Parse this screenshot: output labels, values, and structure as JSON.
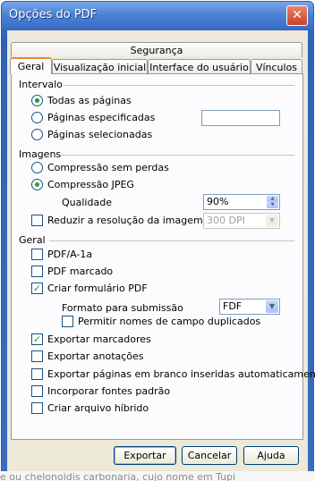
{
  "window": {
    "title": "Opções do PDF",
    "close": "✕"
  },
  "tabs": {
    "row1": [
      "Segurança"
    ],
    "row2": [
      "Geral",
      "Visualização inicial",
      "Interface do usuário",
      "Vínculos"
    ],
    "active": "Geral"
  },
  "intervalo": {
    "title": "Intervalo",
    "all_pages": "Todas as páginas",
    "specified_pages": "Páginas especificadas",
    "selected_pages": "Páginas selecionadas",
    "specified_value": ""
  },
  "imagens": {
    "title": "Imagens",
    "lossless": "Compressão sem perdas",
    "jpeg": "Compressão JPEG",
    "quality_label": "Qualidade",
    "quality_value": "90%",
    "reduce_label": "Reduzir a resolução da imagem",
    "reduce_value": "300 DPI"
  },
  "geral": {
    "title": "Geral",
    "pdfa": "PDF/A-1a",
    "tagged": "PDF marcado",
    "form": "Criar formulário PDF",
    "submit_label": "Formato para submissão",
    "submit_value": "FDF",
    "duplicate_names": "Permitir nomes de campo duplicados",
    "bookmarks": "Exportar marcadores",
    "notes": "Exportar anotações",
    "blank_pages": "Exportar páginas em branco inseridas automaticamente",
    "fonts": "Incorporar fontes padrão",
    "hybrid": "Criar arquivo híbrido"
  },
  "buttons": {
    "export": "Exportar",
    "cancel": "Cancelar",
    "help": "Ajuda"
  },
  "background_text": "e ou chelonoidis carbonaria, cujo nome em Tupi",
  "colors": {
    "titlebar": "#3a6fc6",
    "client": "#ece9d8",
    "check": "#21a121"
  }
}
